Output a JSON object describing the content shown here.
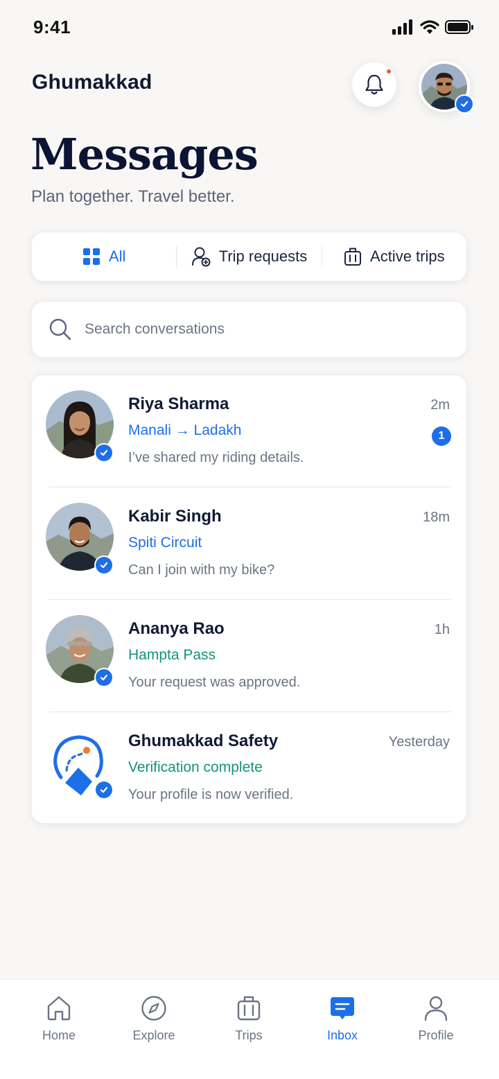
{
  "status_bar": {
    "time": "9:41"
  },
  "header": {
    "brand": "Ghumakkad"
  },
  "page": {
    "title": "Messages",
    "subtitle": "Plan together. Travel better."
  },
  "filters": [
    {
      "label": "All",
      "icon": "grid-icon",
      "active": true
    },
    {
      "label": "Trip requests",
      "icon": "user-plus-icon",
      "active": false
    },
    {
      "label": "Active trips",
      "icon": "luggage-icon",
      "active": false
    }
  ],
  "search": {
    "placeholder": "Search conversations",
    "value": ""
  },
  "conversations": [
    {
      "name": "Riya Sharma",
      "trip": "Manali → Ladakh",
      "trip_color": "#1d6fe8",
      "preview": "I’ve shared my riding details.",
      "time": "2m",
      "unread": "1",
      "verified": true
    },
    {
      "name": "Kabir Singh",
      "trip": "Spiti Circuit",
      "trip_color": "#1d6fe8",
      "preview": "Can I join with my bike?",
      "time": "18m",
      "verified": true
    },
    {
      "name": "Ananya Rao",
      "trip": "Hampta Pass",
      "trip_color": "#14937a",
      "preview": "Your request was approved.",
      "time": "1h",
      "verified": true
    },
    {
      "name": "Ghumakkad Safety",
      "trip": "Verification complete",
      "trip_color": "#14937a",
      "preview": "Your profile is now verified.",
      "time": "Yesterday",
      "verified": true
    }
  ],
  "tabbar": [
    {
      "label": "Home",
      "icon": "home-icon",
      "active": false
    },
    {
      "label": "Explore",
      "icon": "compass-icon",
      "active": false
    },
    {
      "label": "Trips",
      "icon": "luggage-icon",
      "active": false
    },
    {
      "label": "Inbox",
      "icon": "inbox-chat-icon",
      "active": true
    },
    {
      "label": "Profile",
      "icon": "person-icon",
      "active": false
    }
  ],
  "colors": {
    "accent": "#1d6fe8",
    "teal": "#14937a",
    "notification_dot": "#f05a28",
    "background": "#f8f7f5"
  }
}
